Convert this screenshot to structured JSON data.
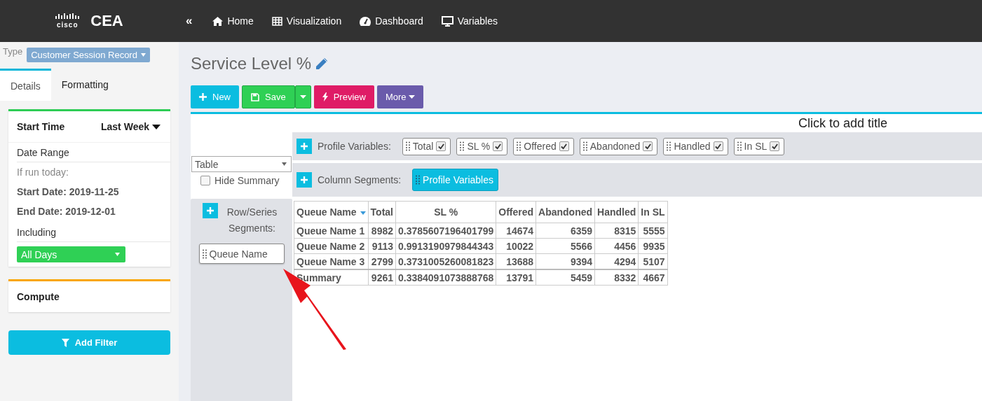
{
  "brand": {
    "mark": "cisco",
    "name": "CEA"
  },
  "nav": {
    "collapse": "«",
    "items": [
      {
        "label": "Home",
        "kind": "home"
      },
      {
        "label": "Visualization",
        "kind": "grid"
      },
      {
        "label": "Dashboard",
        "kind": "gauge"
      },
      {
        "label": "Variables",
        "kind": "monitor"
      }
    ]
  },
  "sidebar": {
    "type_label": "Type",
    "type_value": "Customer Session Record",
    "tabs": [
      {
        "label": "Details",
        "selected": true
      },
      {
        "label": "Formatting",
        "selected": false
      }
    ],
    "start_time": {
      "label": "Start Time",
      "value": "Last Week"
    },
    "date_range": "Date Range",
    "if_run": "If run today:",
    "start_date": "Start Date: 2019-11-25",
    "end_date": "End Date: 2019-12-01",
    "including": "Including",
    "days": "All Days",
    "compute": "Compute",
    "add_filter": "Add Filter"
  },
  "title": "Service Level %",
  "toolbar": [
    {
      "label": "New",
      "kind": "new"
    },
    {
      "label": "Save",
      "kind": "save"
    },
    {
      "label": "Preview",
      "kind": "preview"
    },
    {
      "label": "More",
      "kind": "more"
    }
  ],
  "chart_title": "Click to add title",
  "display_type": "Table",
  "hide_summary": {
    "label": "Hide Summary",
    "checked": false
  },
  "profile_variables": {
    "label": "Profile Variables:",
    "items": [
      {
        "label": "Total",
        "checked": true
      },
      {
        "label": "SL %",
        "checked": true
      },
      {
        "label": "Offered",
        "checked": true
      },
      {
        "label": "Abandoned",
        "checked": true
      },
      {
        "label": "Handled",
        "checked": true
      },
      {
        "label": "In SL",
        "checked": true
      }
    ]
  },
  "column_segments": {
    "label": "Column Segments:",
    "items": [
      "Profile Variables"
    ]
  },
  "row_segments": {
    "label": "Row/Series Segments:",
    "items": [
      "Queue Name"
    ]
  },
  "table": {
    "columns": [
      "Queue Name",
      "Total",
      "SL %",
      "Offered",
      "Abandoned",
      "Handled",
      "In SL"
    ],
    "rows": [
      [
        "Queue Name 1",
        "8982",
        "0.3785607196401799",
        "14674",
        "6359",
        "8315",
        "5555"
      ],
      [
        "Queue Name 2",
        "9113",
        "0.9913190979844343",
        "10022",
        "5566",
        "4456",
        "9935"
      ],
      [
        "Queue Name 3",
        "2799",
        "0.3731005260081823",
        "13688",
        "9394",
        "4294",
        "5107"
      ]
    ],
    "summary": [
      "Summary",
      "9261",
      "0.3384091073888768",
      "13791",
      "5459",
      "8332",
      "4667"
    ]
  }
}
